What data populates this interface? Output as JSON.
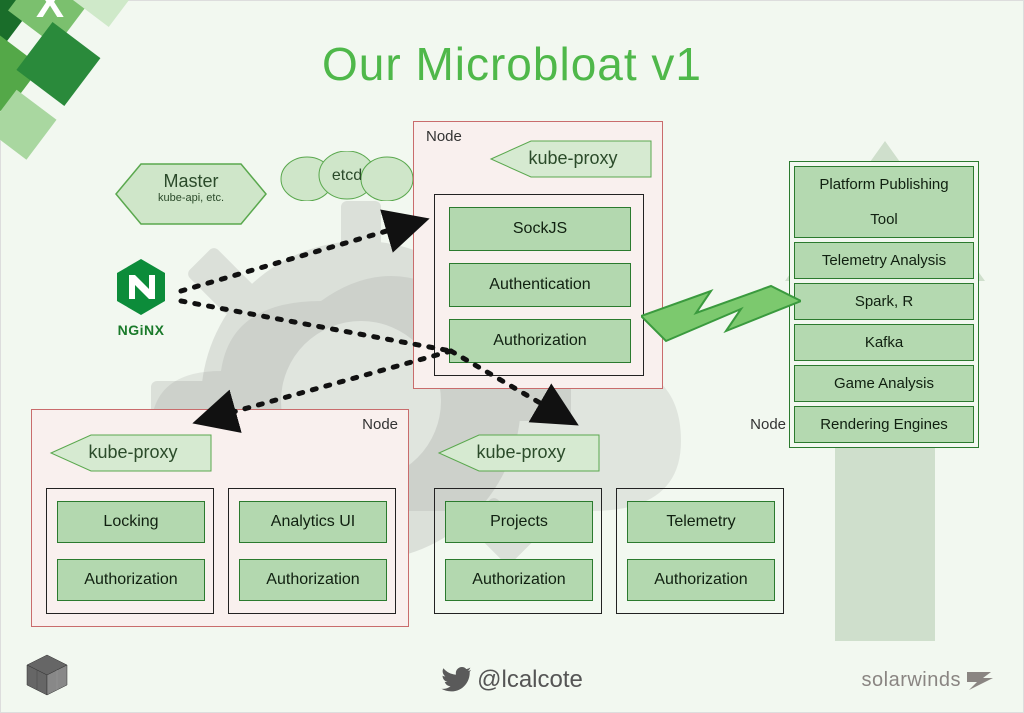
{
  "title": "Our Microbloat v1",
  "master": {
    "title": "Master",
    "subtitle": "kube-api, etc."
  },
  "etcd": "etcd",
  "nginx_word": "NGiNX",
  "nodes": {
    "top": {
      "label": "Node",
      "proxy": "kube-proxy",
      "services": [
        "SockJS",
        "Authentication",
        "Authorization"
      ]
    },
    "bottom_left": {
      "label": "Node",
      "proxy": "kube-proxy",
      "pods": [
        {
          "services": [
            "Locking",
            "Authorization"
          ]
        },
        {
          "services": [
            "Analytics UI",
            "Authorization"
          ]
        }
      ]
    },
    "bottom_right": {
      "label": "Node",
      "proxy": "kube-proxy",
      "pods": [
        {
          "services": [
            "Projects",
            "Authorization"
          ]
        },
        {
          "services": [
            "Telemetry",
            "Authorization"
          ]
        }
      ]
    }
  },
  "stack": [
    "Platform Publishing",
    "Tool",
    "Telemetry Analysis",
    "Spark, R",
    "Kafka",
    "Game Analysis",
    "Rendering Engines"
  ],
  "footer": {
    "twitter": "@lcalcote",
    "vendor": "solarwinds"
  }
}
